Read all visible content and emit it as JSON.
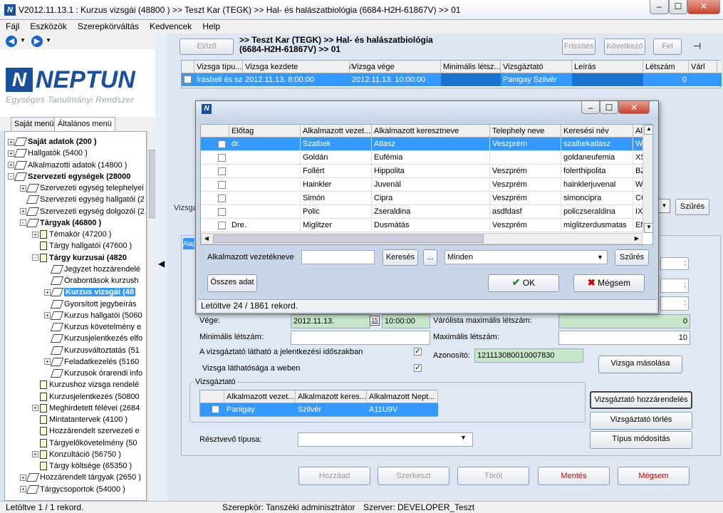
{
  "window": {
    "title": "V2012.11.13.1 : Kurzus vizsgái (48800  ) >> Teszt Kar (TEGK) >> Hal- és halászatbiológia (6684-H2H-61867V) >> 01",
    "min": "–",
    "max": "☐",
    "close": "✕"
  },
  "menu": [
    "Fájl",
    "Eszközök",
    "Szerepkörváltás",
    "Kedvencek",
    "Help"
  ],
  "logo": {
    "name": "NEPTUN",
    "subtitle": "Egységes Tanulmányi Rendszer",
    "mark": "N"
  },
  "left_tabs": [
    "Saját menü",
    "Általános menü"
  ],
  "tree": [
    {
      "label": "Saját adatok (200  )",
      "bold": true,
      "indent": 0,
      "icon": "node",
      "ex": "+"
    },
    {
      "label": "Hallgatók (5400  )",
      "bold": false,
      "indent": 0,
      "icon": "node",
      "ex": "+"
    },
    {
      "label": "Alkalmazotti adatok (14800  )",
      "bold": false,
      "indent": 0,
      "icon": "node",
      "ex": "+"
    },
    {
      "label": "Szervezeti egységek (28000",
      "bold": true,
      "indent": 0,
      "icon": "node",
      "ex": "-"
    },
    {
      "label": "Szervezeti egység telephelyei",
      "bold": false,
      "indent": 1,
      "icon": "grid",
      "ex": "+"
    },
    {
      "label": "Szervezeti egység hallgatói (2",
      "bold": false,
      "indent": 1,
      "icon": "grid",
      "ex": ""
    },
    {
      "label": "Szervezeti egység dolgozói (2",
      "bold": false,
      "indent": 1,
      "icon": "grid",
      "ex": "+"
    },
    {
      "label": "Tárgyak (46800  )",
      "bold": true,
      "indent": 1,
      "icon": "grid",
      "ex": "-"
    },
    {
      "label": "Témakör (47200  )",
      "bold": false,
      "indent": 2,
      "icon": "doc",
      "ex": "+"
    },
    {
      "label": "Tárgy hallgatói (47600  )",
      "bold": false,
      "indent": 2,
      "icon": "doc",
      "ex": ""
    },
    {
      "label": "Tárgy kurzusai (4820",
      "bold": true,
      "indent": 2,
      "icon": "doc",
      "ex": "-"
    },
    {
      "label": "Jegyzet hozzárendelé",
      "bold": false,
      "indent": 3,
      "icon": "node",
      "ex": ""
    },
    {
      "label": "Órabontások kurzush",
      "bold": false,
      "indent": 3,
      "icon": "node",
      "ex": ""
    },
    {
      "label": "Kurzus vizsgái (48",
      "bold": true,
      "indent": 3,
      "icon": "node",
      "ex": "+",
      "selected": true
    },
    {
      "label": "Gyorsított jegybeírás",
      "bold": false,
      "indent": 3,
      "icon": "node",
      "ex": ""
    },
    {
      "label": "Kurzus hallgatói (5060",
      "bold": false,
      "indent": 3,
      "icon": "node",
      "ex": "+"
    },
    {
      "label": "Kurzus követelmény e",
      "bold": false,
      "indent": 3,
      "icon": "node",
      "ex": ""
    },
    {
      "label": "Kurzusjelentkezés elfo",
      "bold": false,
      "indent": 3,
      "icon": "node",
      "ex": ""
    },
    {
      "label": "Kurzusváltoztatás (51",
      "bold": false,
      "indent": 3,
      "icon": "node",
      "ex": ""
    },
    {
      "label": "Feladatkezelés (5160",
      "bold": false,
      "indent": 3,
      "icon": "node",
      "ex": "+"
    },
    {
      "label": "Kurzusok órarendi info",
      "bold": false,
      "indent": 3,
      "icon": "node",
      "ex": ""
    },
    {
      "label": "Kurzushoz vizsga rendelé",
      "bold": false,
      "indent": 2,
      "icon": "doc",
      "ex": ""
    },
    {
      "label": "Kurzusjelentkezés (50800",
      "bold": false,
      "indent": 2,
      "icon": "doc",
      "ex": ""
    },
    {
      "label": "Meghirdetett félévei (2684",
      "bold": false,
      "indent": 2,
      "icon": "doc",
      "ex": "+"
    },
    {
      "label": "Mintatantervek (4100  )",
      "bold": false,
      "indent": 2,
      "icon": "doc",
      "ex": ""
    },
    {
      "label": "Hozzárendelt szervezeti e",
      "bold": false,
      "indent": 2,
      "icon": "doc",
      "ex": ""
    },
    {
      "label": "Tárgyelőkövetelmény (50",
      "bold": false,
      "indent": 2,
      "icon": "doc",
      "ex": ""
    },
    {
      "label": "Konzultáció (56750  )",
      "bold": false,
      "indent": 2,
      "icon": "doc",
      "ex": "+"
    },
    {
      "label": "Tárgy költsége (65350  )",
      "bold": false,
      "indent": 2,
      "icon": "doc",
      "ex": ""
    },
    {
      "label": "Hozzárendelt tárgyak (2650  )",
      "bold": false,
      "indent": 1,
      "icon": "grid",
      "ex": "+"
    },
    {
      "label": "Tárgycsoportok (54000  )",
      "bold": false,
      "indent": 1,
      "icon": "grid",
      "ex": "+"
    }
  ],
  "top": {
    "prev": "Előző",
    "next": "Következő",
    "refresh": "Frissítés",
    "up": "Fel",
    "breadcrumb_line1": ">> Teszt Kar (TEGK) >> Hal- és halászatbiológia",
    "breadcrumb_line2": "(6684-H2H-61867V) >> 01"
  },
  "exam_grid": {
    "headers": [
      "Vizsga típu...",
      "Vizsga kezdete",
      "Vizsga vége",
      "Minimális létsz...",
      "Vizsgáztató",
      "Leírás",
      "Létszám",
      "Várl"
    ],
    "row": [
      "Írásbeli és szó",
      "2012.11.13. 8:00:00",
      "2012.11.13. 10:00:00",
      "",
      "Panigay Szilvér",
      "",
      "0",
      ""
    ]
  },
  "dialog": {
    "headers": [
      "Előtag",
      "Alkalmazott vezet...",
      "Alkalmazott keresztneve",
      "Telephely neve",
      "Keresési név",
      "Al"
    ],
    "rows": [
      [
        "dr.",
        "Szalbek",
        "Atlasz",
        "Veszprém",
        "szalbekatlasz",
        "W"
      ],
      [
        "",
        "Goldán",
        "Eufémia",
        "",
        "goldaneufemia",
        "XS"
      ],
      [
        "",
        "Follért",
        "Hippolita",
        "Veszprém",
        "folerthipolita",
        "BZ"
      ],
      [
        "",
        "Hainkler",
        "Juvenál",
        "Veszprém",
        "hainklerjuvenal",
        "W"
      ],
      [
        "",
        "Simón",
        "Cipra",
        "Veszprém",
        "simoncipra",
        "CO"
      ],
      [
        "",
        "Polic",
        "Zseraldina",
        "asdfdasf",
        "policzseraldina",
        "IX"
      ],
      [
        "Dre.",
        "Miglitzer",
        "Dusmátás",
        "Veszprém",
        "miglitzerdusmatas",
        "EN"
      ]
    ],
    "search_label": "Alkalmazott vezetékneve",
    "search_value": "",
    "search_btn": "Keresés",
    "dots_btn": "...",
    "filter_value": "Minden",
    "filter_btn": "Szűrés",
    "all_btn": "Összes adat",
    "ok": "OK",
    "cancel": "Mégsem",
    "status": "Letöltve 24 / 1861 rekord."
  },
  "form": {
    "tab_label": "Alap",
    "vege_label": "Vége:",
    "vege_date": "2012.11.13.",
    "vege_time": "10:00:00",
    "calendar_icon": "15",
    "min_label": "Minimális létszám:",
    "visible_label": "A vizsgáztató látható a jelentkezési időszakban",
    "web_label": "Vizsga láthatósága a weben",
    "waitlist_label": "Várólista maximális létszám:",
    "waitlist_value": "0",
    "max_label": "Maximális létszám:",
    "max_value": "10",
    "id_label": "Azonosító:",
    "id_value": "121113080010007830",
    "copy_btn": "Vizsga másolása",
    "filter_btn": "Szűrés",
    "vizsga_label": "Vizsga",
    "examiner_group": "Vizsgáztató",
    "examiner_headers": [
      "Alkalmazott vezet...",
      "Alkalmazott keres...",
      "Alkalmazott Nept..."
    ],
    "examiner_row": [
      "Panigay",
      "Szilvér",
      "A11U9V"
    ],
    "assign_btn": "Vizsgáztató hozzárendelés",
    "delete_btn": "Vizsgáztató törlés",
    "type_btn": "Típus módosítás",
    "participant_label": "Résztvevő típusa:"
  },
  "bottom": {
    "add": "Hozzáad",
    "edit": "Szerkeszt",
    "delete": "Töröl",
    "save": "Mentés",
    "cancel": "Mégsem"
  },
  "status": {
    "left": "Letöltve 1 / 1 rekord.",
    "role": "Szerepkör: Tanszéki adminisztrátor",
    "server": "Szerver: DEVELOPER_Teszt"
  }
}
